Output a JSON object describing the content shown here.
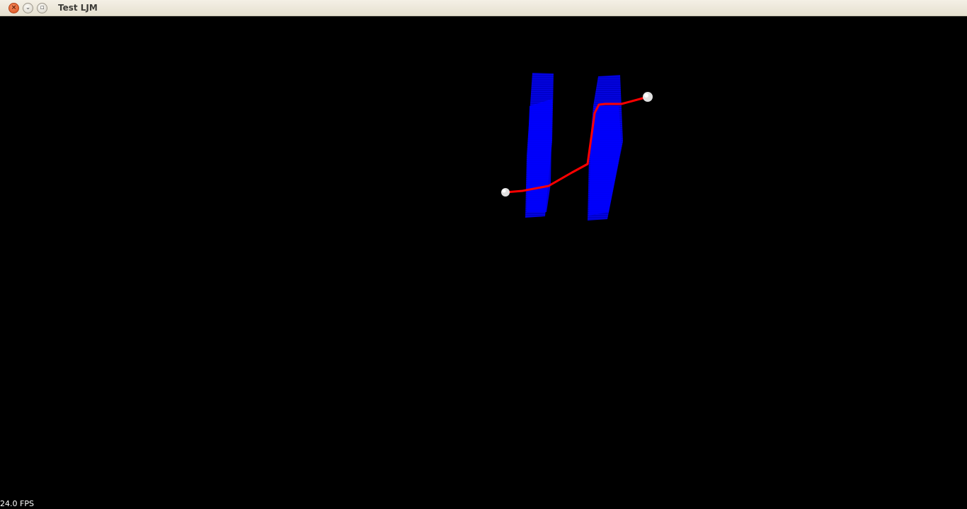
{
  "window": {
    "title": "Test LJM",
    "buttons": {
      "close_glyph": "×",
      "minimize_glyph": "⌄",
      "maximize_glyph": "▫"
    }
  },
  "scene": {
    "background_color": "#000000",
    "molecule_color": "#0000ff",
    "path_color": "#ff0000",
    "endpoint_color": "#e8e8e8"
  },
  "status": {
    "fps_text": "24.0 FPS"
  }
}
